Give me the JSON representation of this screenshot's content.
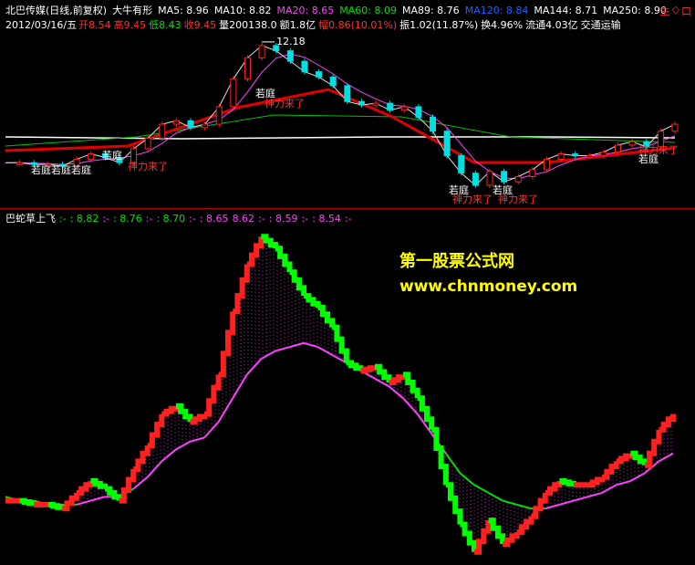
{
  "header": {
    "title": "北巴传媒(日线,前复权)",
    "indicator_name": "大牛有形",
    "ma": [
      {
        "label": "MA5: 8.96",
        "color": "#ffffff"
      },
      {
        "label": "MA10: 8.82",
        "color": "#ffffff"
      },
      {
        "label": "MA20: 8.65",
        "color": "#ff40ff"
      },
      {
        "label": "MA60: 8.09",
        "color": "#00e000"
      },
      {
        "label": "MA89: 8.76",
        "color": "#ffffff"
      },
      {
        "label": "MA120: 8.84",
        "color": "#2060ff"
      },
      {
        "label": "MA144: 8.71",
        "color": "#ffffff"
      },
      {
        "label": "MA250: 8.90",
        "color": "#ffffff"
      }
    ]
  },
  "quote": {
    "date": "2012/03/16/五",
    "open": "开8.54",
    "high": "高9.45",
    "low": "低8.43",
    "close": "收9.45",
    "volume": "量200138.0",
    "amount": "额1.8亿",
    "change": "幅0.86(10.01%)",
    "amplitude": "振1.02(11.87%)",
    "turnover": "换4.96%",
    "float": "流通4.03亿",
    "sector": "交通运输"
  },
  "right_icons": [
    "生",
    "◇",
    "口"
  ],
  "top_annotations": {
    "peak_price": "12.18",
    "labels": [
      {
        "text": "若庭若庭若庭",
        "color": "#ffffff"
      },
      {
        "text": "若庭",
        "color": "#ffffff"
      },
      {
        "text": "神力来了",
        "color": "#ff3030"
      },
      {
        "text": "若庭",
        "color": "#ffffff"
      },
      {
        "text": "神力来了",
        "color": "#ff3030"
      },
      {
        "text": "若庭",
        "color": "#ffffff"
      },
      {
        "text": "神力来了",
        "color": "#ff3030"
      },
      {
        "text": "若庭",
        "color": "#ffffff"
      },
      {
        "text": "神力来了",
        "color": "#ff3030"
      },
      {
        "text": "若庭",
        "color": "#ffffff"
      },
      {
        "text": "神力来了",
        "color": "#ff3030"
      }
    ]
  },
  "sub_indicator": {
    "name": "巴蛇草上飞",
    "values": [
      {
        "label": ":-",
        "color": "#00e000"
      },
      {
        "label": ": 8.82",
        "color": "#00e000"
      },
      {
        "label": ":-",
        "color": "#ff40ff"
      },
      {
        "label": ": 8.76",
        "color": "#00e000"
      },
      {
        "label": ":-",
        "color": "#ff40ff"
      },
      {
        "label": ": 8.70",
        "color": "#00e000"
      },
      {
        "label": ":-",
        "color": "#ff40ff"
      },
      {
        "label": ": 8.65",
        "color": "#ff40ff"
      },
      {
        "label": "8.62",
        "color": "#ff40ff"
      },
      {
        "label": ":-",
        "color": "#ff40ff"
      },
      {
        "label": ": 8.59",
        "color": "#ff40ff"
      },
      {
        "label": ":-",
        "color": "#ff40ff"
      },
      {
        "label": ": 8.54",
        "color": "#ff40ff"
      },
      {
        "label": ":-",
        "color": "#ff40ff"
      }
    ]
  },
  "watermark": {
    "line1": "第一股票公式网",
    "line2": "www.chnmoney.com"
  },
  "chart_data": {
    "type": "line",
    "series": [
      {
        "values": [
          5.4,
          5.4,
          5.3,
          5.3,
          5.2,
          5.6,
          5.9,
          5.7,
          5.4,
          6.2,
          6.8,
          7.6,
          7.8,
          7.4,
          7.6,
          8.6,
          10.2,
          11.4,
          12.1,
          11.8,
          11.2,
          10.6,
          10.3,
          9.8,
          8.9,
          8.7,
          8.8,
          8.4,
          8.6,
          8.0,
          7.2,
          5.8,
          4.8,
          4.1,
          4.9,
          4.3,
          4.6,
          5.0,
          5.6,
          5.9,
          5.8,
          5.8,
          6.0,
          6.4,
          6.6,
          6.3,
          7.2,
          7.6
        ]
      },
      {
        "values": [
          5.5,
          5.4,
          5.4,
          5.3,
          5.3,
          5.3,
          5.4,
          5.5,
          5.5,
          5.7,
          6.0,
          6.4,
          6.7,
          6.9,
          7.0,
          7.4,
          8.0,
          8.6,
          9.0,
          9.2,
          9.3,
          9.4,
          9.3,
          9.1,
          8.9,
          8.7,
          8.5,
          8.3,
          8.0,
          7.6,
          7.1,
          6.6,
          6.1,
          5.8,
          5.6,
          5.4,
          5.3,
          5.2,
          5.2,
          5.3,
          5.4,
          5.5,
          5.6,
          5.8,
          5.9,
          6.1,
          6.4,
          6.6
        ]
      }
    ]
  }
}
